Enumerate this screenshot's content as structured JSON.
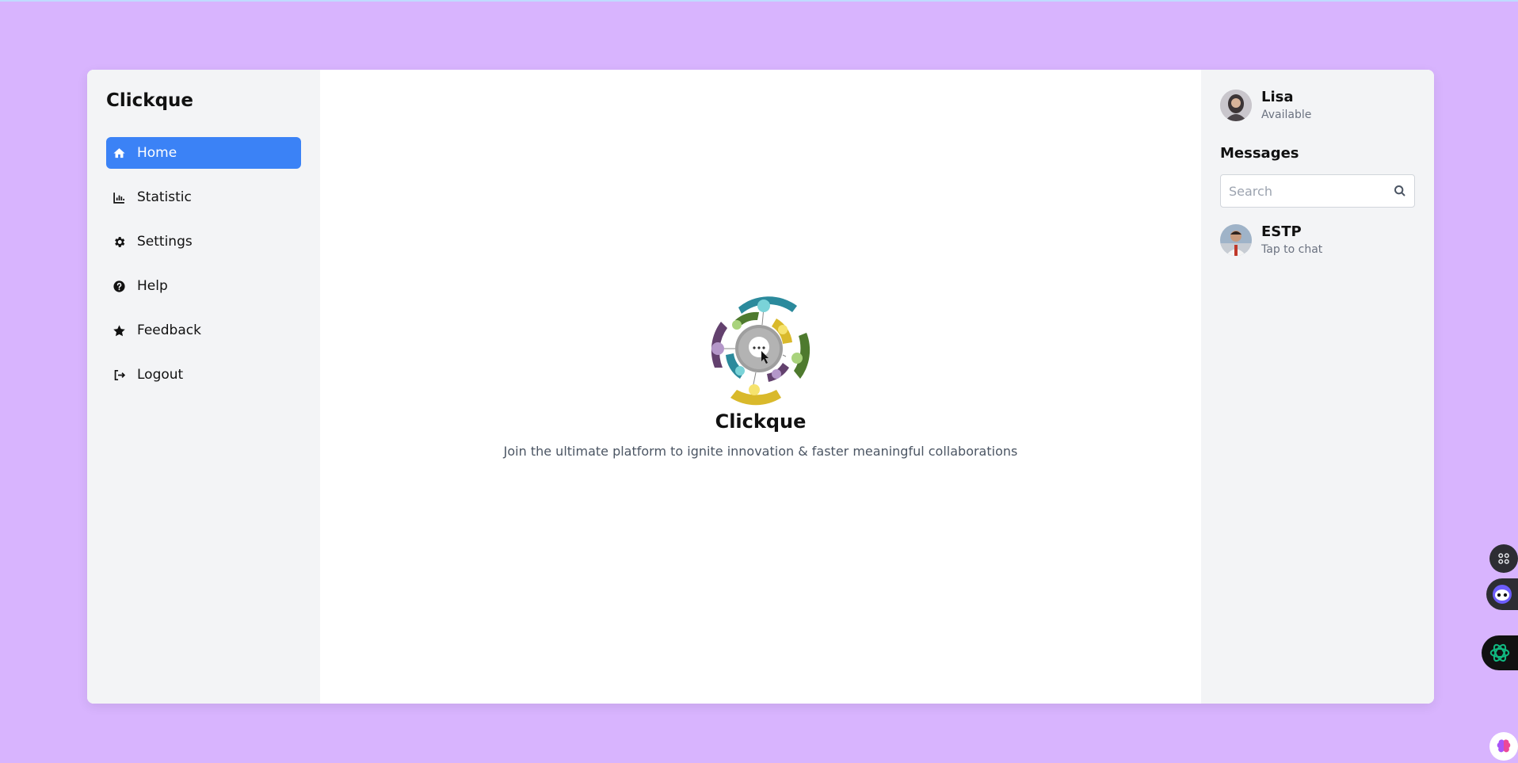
{
  "sidebar": {
    "brand": "Clickque",
    "items": [
      {
        "label": "Home",
        "icon": "home-icon",
        "active": true
      },
      {
        "label": "Statistic",
        "icon": "chart-icon",
        "active": false
      },
      {
        "label": "Settings",
        "icon": "gear-icon",
        "active": false
      },
      {
        "label": "Help",
        "icon": "help-icon",
        "active": false
      },
      {
        "label": "Feedback",
        "icon": "star-icon",
        "active": false
      },
      {
        "label": "Logout",
        "icon": "logout-icon",
        "active": false
      }
    ]
  },
  "main": {
    "title": "Clickque",
    "subtitle": "Join the ultimate platform to ignite innovation & faster meaningful collaborations"
  },
  "right": {
    "profile": {
      "name": "Lisa",
      "status": "Available"
    },
    "messages_title": "Messages",
    "search": {
      "placeholder": "Search",
      "value": ""
    },
    "chats": [
      {
        "name": "ESTP",
        "subtitle": "Tap to chat"
      }
    ]
  },
  "colors": {
    "background": "#d8b4fe",
    "accent": "#3b82f6",
    "panel": "#f3f4f6"
  }
}
